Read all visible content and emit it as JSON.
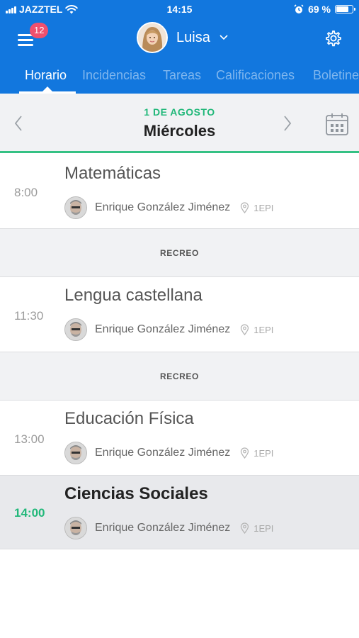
{
  "status_bar": {
    "carrier": "JAZZTEL",
    "time": "14:15",
    "battery_text": "69 %",
    "battery_level": 0.69
  },
  "header": {
    "notification_count": "12",
    "user_name": "Luisa",
    "icons": [
      "hamburger-menu-icon",
      "chevron-down-icon",
      "gear-icon"
    ]
  },
  "tabs": [
    {
      "label": "Horario",
      "active": true
    },
    {
      "label": "Incidencias",
      "active": false
    },
    {
      "label": "Tareas",
      "active": false
    },
    {
      "label": "Calificaciones",
      "active": false
    },
    {
      "label": "Boletine",
      "active": false
    }
  ],
  "date_nav": {
    "date": "1 DE AGOSTO",
    "weekday": "Miércoles"
  },
  "schedule": [
    {
      "time": "8:00",
      "subject": "Matemáticas",
      "teacher": "Enrique González Jiménez",
      "room": "1EPI",
      "current": false
    },
    {
      "break_label": "RECREO"
    },
    {
      "time": "11:30",
      "subject": "Lengua castellana",
      "teacher": "Enrique González Jiménez",
      "room": "1EPI",
      "current": false
    },
    {
      "break_label": "RECREO"
    },
    {
      "time": "13:00",
      "subject": "Educación Física",
      "teacher": "Enrique González Jiménez",
      "room": "1EPI",
      "current": false
    },
    {
      "time": "14:00",
      "subject": "Ciencias Sociales",
      "teacher": "Enrique González Jiménez",
      "room": "1EPI",
      "current": true
    }
  ],
  "colors": {
    "primary": "#1277de",
    "accent_green": "#22b87a",
    "badge": "#f0506e"
  }
}
